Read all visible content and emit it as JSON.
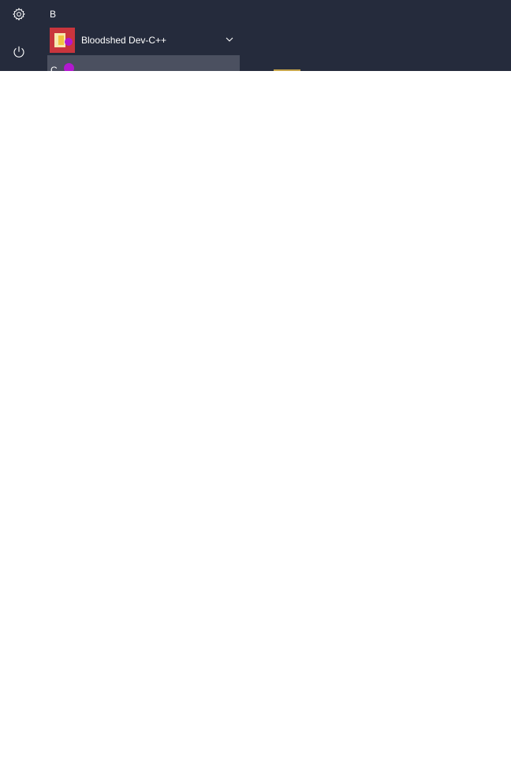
{
  "start_menu": {
    "rail": {
      "settings_icon": "gear-icon",
      "power_icon": "power-icon"
    },
    "sections": [
      {
        "letter": "B",
        "apps": [
          {
            "label": "Bloodshed Dev-C++",
            "icon": "dev-cpp-icon",
            "expandable": true,
            "expand_icon": "chevron-down-icon"
          }
        ]
      },
      {
        "letter": "C"
      }
    ],
    "colors": {
      "background": "#252b3c",
      "hover_row": "#4b5060",
      "app_tile": "#c9353d",
      "cursor": "#b219d0",
      "text": "#ffffff"
    }
  }
}
